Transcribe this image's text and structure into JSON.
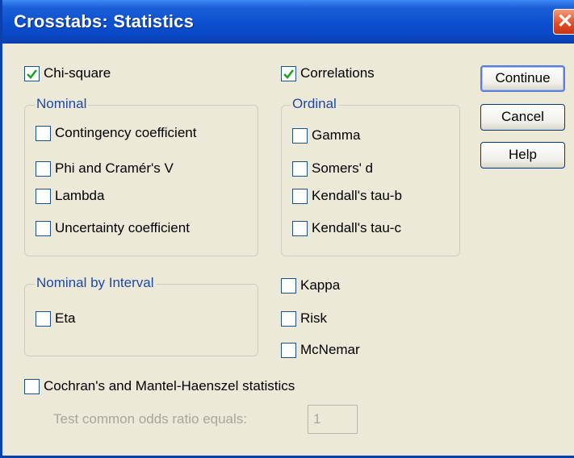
{
  "window": {
    "title": "Crosstabs: Statistics"
  },
  "top_checks": {
    "chi_square": {
      "label": "Chi-square",
      "checked": true
    },
    "correlations": {
      "label": "Correlations",
      "checked": true
    }
  },
  "nominal": {
    "legend": "Nominal",
    "items": [
      {
        "label": "Contingency coefficient",
        "checked": false
      },
      {
        "label": "Phi and Cramér's V",
        "checked": false
      },
      {
        "label": "Lambda",
        "checked": false
      },
      {
        "label": "Uncertainty coefficient",
        "checked": false
      }
    ]
  },
  "ordinal": {
    "legend": "Ordinal",
    "items": [
      {
        "label": "Gamma",
        "checked": false
      },
      {
        "label": "Somers' d",
        "checked": false
      },
      {
        "label": "Kendall's tau-b",
        "checked": false
      },
      {
        "label": "Kendall's tau-c",
        "checked": false
      }
    ]
  },
  "nominal_by_interval": {
    "legend": "Nominal by Interval",
    "items": [
      {
        "label": "Eta",
        "checked": false
      }
    ]
  },
  "other": {
    "items": [
      {
        "label": "Kappa",
        "checked": false
      },
      {
        "label": "Risk",
        "checked": false
      },
      {
        "label": "McNemar",
        "checked": false
      }
    ]
  },
  "cmh": {
    "label": "Cochran's and Mantel-Haenszel statistics",
    "checked": false,
    "odds_label": "Test common odds ratio equals:",
    "odds_value": "1"
  },
  "buttons": {
    "continue": "Continue",
    "cancel": "Cancel",
    "help": "Help"
  },
  "colors": {
    "titlebar": "#0b4fd0",
    "group_label": "#1c48a8",
    "check": "#21a121"
  }
}
